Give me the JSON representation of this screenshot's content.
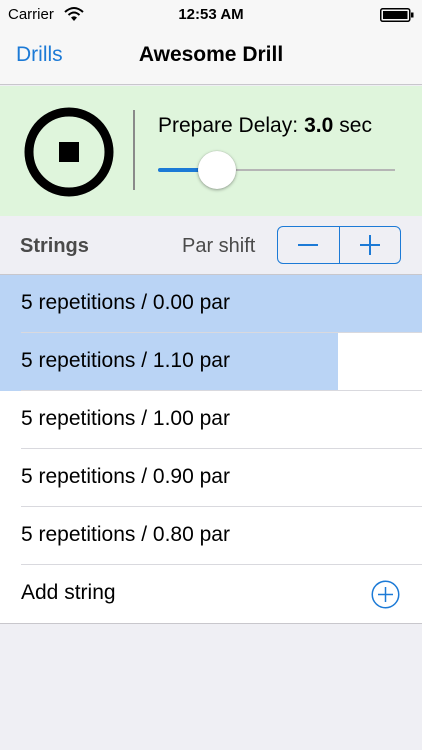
{
  "status_bar": {
    "carrier": "Carrier",
    "time": "12:53 AM"
  },
  "nav": {
    "back_label": "Drills",
    "title": "Awesome Drill"
  },
  "control": {
    "delay_label": "Prepare Delay:",
    "delay_value": "3.0",
    "delay_unit": "sec",
    "slider_fraction": 0.2
  },
  "section": {
    "title": "Strings",
    "par_shift_label": "Par shift"
  },
  "strings": [
    {
      "label": "5 repetitions / 0.00 par",
      "progress": 1.0
    },
    {
      "label": "5 repetitions / 1.10 par",
      "progress": 0.8
    },
    {
      "label": "5 repetitions / 1.00 par",
      "progress": 0
    },
    {
      "label": "5 repetitions / 0.90 par",
      "progress": 0
    },
    {
      "label": "5 repetitions / 0.80 par",
      "progress": 0
    }
  ],
  "add_string_label": "Add string",
  "colors": {
    "accent": "#1c7ad6",
    "panel_bg": "#dff5dc",
    "progress_fill": "#bad4f5",
    "page_bg": "#efeff4"
  },
  "icons": {
    "wifi": "wifi-icon",
    "battery": "battery-icon",
    "stop": "stop-icon",
    "minus": "minus-icon",
    "plus": "plus-icon",
    "add": "add-circle-icon"
  }
}
